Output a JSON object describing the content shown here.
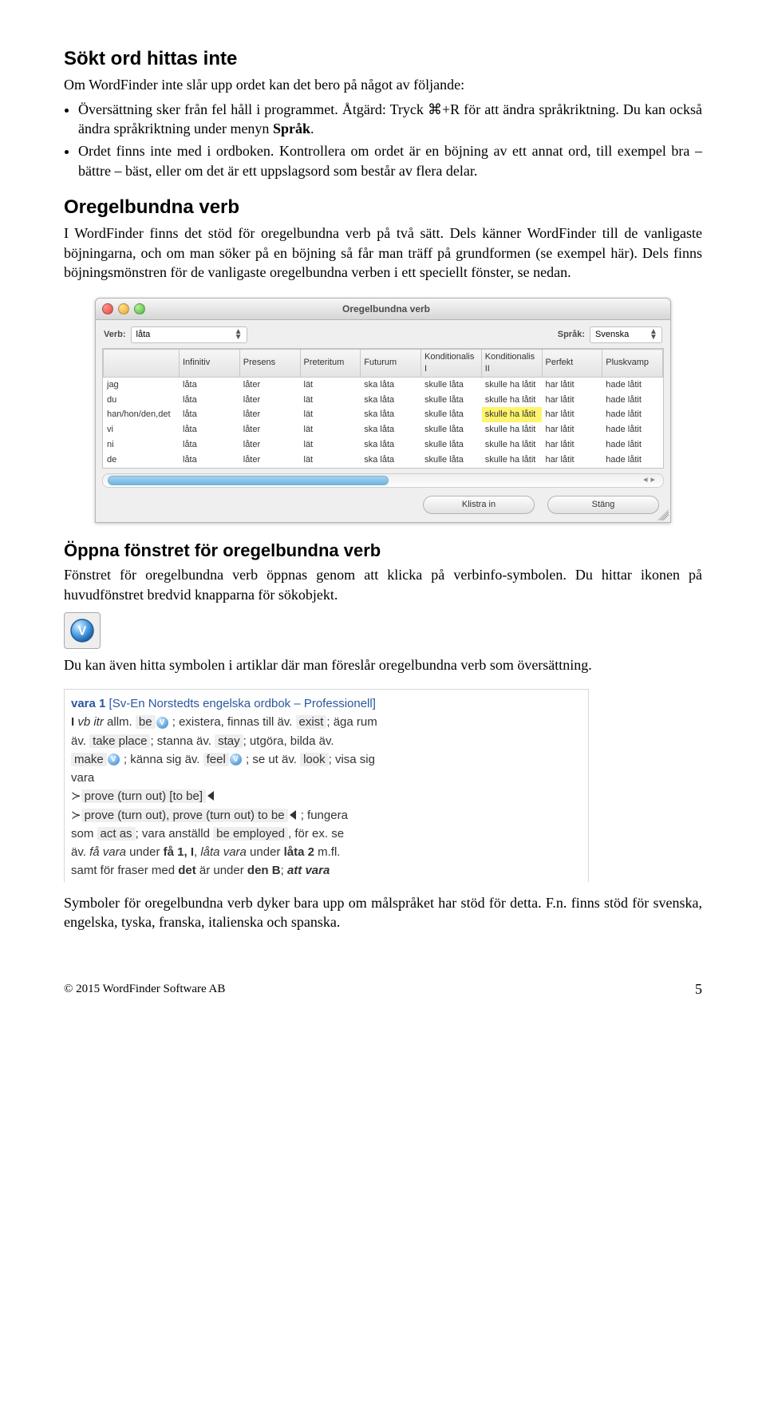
{
  "h_sokt": "Sökt ord hittas inte",
  "intro": "Om WordFinder inte slår upp ordet kan det bero på något av följande:",
  "bullets": [
    "Översättning sker från fel håll i programmet. Åtgärd: Tryck ⌘+R för att ändra språkriktning. Du kan också ändra språkriktning under menyn ",
    "Ordet finns inte med i ordboken. Kontrollera om ordet är en böjning av ett annat ord, till exempel bra – bättre – bäst, eller om det är ett uppslagsord som består av flera delar."
  ],
  "sprak_bold": "Språk",
  "h_oregel": "Oregelbundna verb",
  "para_oregel": "I WordFinder finns det stöd för oregelbundna verb på två sätt. Dels känner WordFinder till de vanligaste böjningarna, och om man söker på en böjning så får man träff på grundformen (se exempel här). Dels finns böjningsmönstren för de vanligaste oregelbundna verben i ett speciellt fönster, se nedan.",
  "win": {
    "title": "Oregelbundna verb",
    "verb_lbl": "Verb:",
    "verb_value": "låta",
    "lang_lbl": "Språk:",
    "lang_value": "Svenska",
    "cols": [
      "",
      "Infinitiv",
      "Presens",
      "Preteritum",
      "Futurum",
      "Konditionalis I",
      "Konditionalis II",
      "Perfekt",
      "Pluskvamp"
    ],
    "rows": [
      [
        "jag",
        "låta",
        "låter",
        "lät",
        "ska låta",
        "skulle låta",
        "skulle ha låtit",
        "har låtit",
        "hade låtit"
      ],
      [
        "du",
        "låta",
        "låter",
        "lät",
        "ska låta",
        "skulle låta",
        "skulle ha låtit",
        "har låtit",
        "hade låtit"
      ],
      [
        "han/hon/den,det",
        "låta",
        "låter",
        "lät",
        "ska låta",
        "skulle låta",
        "skulle ha låtit",
        "har låtit",
        "hade låtit"
      ],
      [
        "vi",
        "låta",
        "låter",
        "lät",
        "ska låta",
        "skulle låta",
        "skulle ha låtit",
        "har låtit",
        "hade låtit"
      ],
      [
        "ni",
        "låta",
        "låter",
        "lät",
        "ska låta",
        "skulle låta",
        "skulle ha låtit",
        "har låtit",
        "hade låtit"
      ],
      [
        "de",
        "låta",
        "låter",
        "lät",
        "ska låta",
        "skulle låta",
        "skulle ha låtit",
        "har låtit",
        "hade låtit"
      ]
    ],
    "highlight": {
      "row": 2,
      "col": 6
    },
    "paste_btn": "Klistra in",
    "close_btn": "Stäng"
  },
  "h_open": "Öppna fönstret för oregelbundna verb",
  "para_open": "Fönstret för oregelbundna verb öppnas genom att klicka på verbinfo-symbolen. Du hittar ikonen på huvudfönstret bredvid knapparna för sökobjekt.",
  "para_hint": "Du kan även hitta symbolen i artiklar där man föreslår oregelbundna verb som översättning.",
  "entry": {
    "head": "vara 1",
    "src": " [Sv-En Norstedts engelska ordbok – Professionell]",
    "l1a": "I ",
    "l1b": "vb itr",
    "l1c": " allm. ",
    "l1d": "be",
    "l1e": " ; existera, finnas till äv. ",
    "l1f": "exist",
    "l1g": "; äga rum",
    "l2a": "äv. ",
    "l2b": "take place",
    "l2c": "; stanna äv. ",
    "l2d": "stay",
    "l2e": "; utgöra, bilda äv.",
    "l3a": "make",
    "l3b": " ; känna sig äv. ",
    "l3c": "feel",
    "l3d": " ; se ut äv. ",
    "l3e": "look",
    "l3f": "; visa sig",
    "l4": "vara",
    "l5a": "≻",
    "l5b": "prove (turn out) [to be]",
    "l6a": "≻",
    "l6b": "prove (turn out), prove (turn out) to be",
    "l6c": " ; fungera",
    "l7a": "som ",
    "l7b": "act as",
    "l7c": "; vara anställd ",
    "l7d": "be employed",
    "l7e": ", för ex. se",
    "l8a": "äv. ",
    "l8b": "få vara",
    "l8c": " under ",
    "l8d": "få 1, I",
    "l8e": ", ",
    "l8f": "låta vara",
    "l8g": " under ",
    "l8h": "låta 2",
    "l8i": " m.fl.",
    "l9a": "samt för fraser med ",
    "l9b": "det",
    "l9c": " är under ",
    "l9d": "den B",
    "l9e": "; ",
    "l9f": "att vara"
  },
  "para_symbols": "Symboler för oregelbundna verb dyker bara upp om målspråket har stöd för detta. F.n. finns stöd för svenska, engelska, tyska, franska, italienska och spanska.",
  "copyright": "© 2015 WordFinder Software AB",
  "page": "5"
}
